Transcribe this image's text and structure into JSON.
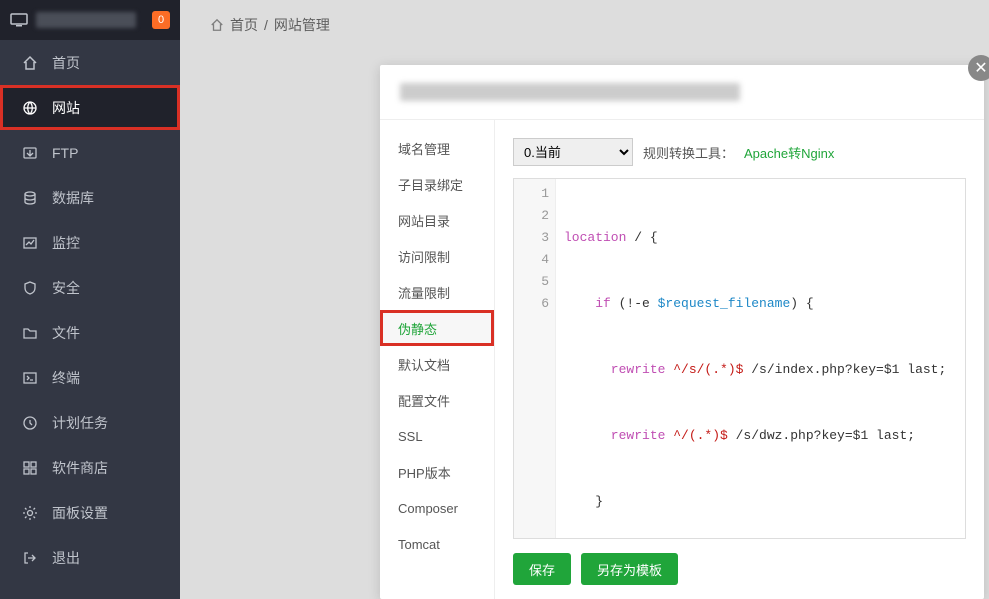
{
  "topbar": {
    "badge": "0"
  },
  "sidebar": {
    "items": [
      {
        "label": "首页"
      },
      {
        "label": "网站"
      },
      {
        "label": "FTP"
      },
      {
        "label": "数据库"
      },
      {
        "label": "监控"
      },
      {
        "label": "安全"
      },
      {
        "label": "文件"
      },
      {
        "label": "终端"
      },
      {
        "label": "计划任务"
      },
      {
        "label": "软件商店"
      },
      {
        "label": "面板设置"
      },
      {
        "label": "退出"
      }
    ]
  },
  "breadcrumb": {
    "home": "首页",
    "sep": "/",
    "current": "网站管理"
  },
  "modal": {
    "sidebar": [
      "域名管理",
      "子目录绑定",
      "网站目录",
      "访问限制",
      "流量限制",
      "伪静态",
      "默认文档",
      "配置文件",
      "SSL",
      "PHP版本",
      "Composer",
      "Tomcat"
    ],
    "toolbar": {
      "select_value": "0.当前",
      "label": "规则转换工具：",
      "link": "Apache转Nginx"
    },
    "code_lines": [
      "1",
      "2",
      "3",
      "4",
      "5",
      "6"
    ],
    "code": {
      "l1a": "location",
      "l1b": " / {",
      "l2a": "    if",
      "l2b": " (!-e ",
      "l2c": "$request_filename",
      "l2d": ") {",
      "l3a": "      rewrite ",
      "l3b": "^/s/(.*)$",
      "l3c": " /s/index.php?key=$1 last;",
      "l4a": "      rewrite ",
      "l4b": "^/(.*)$",
      "l4c": " /s/dwz.php?key=$1 last;",
      "l5": "    }",
      "l6": "}"
    },
    "buttons": {
      "save": "保存",
      "save_as": "另存为模板"
    }
  }
}
